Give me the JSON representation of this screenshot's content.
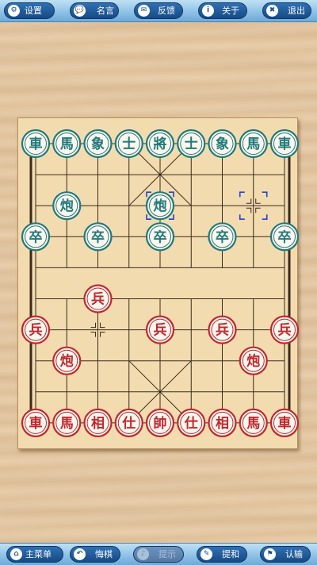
{
  "top_bar": {
    "buttons": [
      {
        "label": "设置",
        "icon": "gear-icon",
        "glyph": "⚙"
      },
      {
        "label": "名言",
        "icon": "speech-bubble-icon",
        "glyph": "💬"
      },
      {
        "label": "反馈",
        "icon": "mail-icon",
        "glyph": "✉"
      },
      {
        "label": "关于",
        "icon": "info-icon",
        "glyph": "i"
      },
      {
        "label": "退出",
        "icon": "close-icon",
        "glyph": "✖"
      }
    ]
  },
  "bottom_bar": {
    "buttons": [
      {
        "label": "主菜单",
        "icon": "home-icon",
        "glyph": "⌂",
        "enabled": true
      },
      {
        "label": "悔棋",
        "icon": "undo-icon",
        "glyph": "↶",
        "enabled": true
      },
      {
        "label": "提示",
        "icon": "bell-icon",
        "glyph": "♪",
        "enabled": false
      },
      {
        "label": "提和",
        "icon": "pencil-icon",
        "glyph": "✎",
        "enabled": true
      },
      {
        "label": "认输",
        "icon": "flag-icon",
        "glyph": "⚑",
        "enabled": true
      }
    ]
  },
  "colors": {
    "black_side": "#1f7a7a",
    "red_side": "#c1272d",
    "selection_marker": "#2244cc"
  },
  "pieces": [
    {
      "side": "black",
      "char": "車",
      "col": 0,
      "row": 0
    },
    {
      "side": "black",
      "char": "馬",
      "col": 1,
      "row": 0
    },
    {
      "side": "black",
      "char": "象",
      "col": 2,
      "row": 0
    },
    {
      "side": "black",
      "char": "士",
      "col": 3,
      "row": 0
    },
    {
      "side": "black",
      "char": "將",
      "col": 4,
      "row": 0
    },
    {
      "side": "black",
      "char": "士",
      "col": 5,
      "row": 0
    },
    {
      "side": "black",
      "char": "象",
      "col": 6,
      "row": 0
    },
    {
      "side": "black",
      "char": "馬",
      "col": 7,
      "row": 0
    },
    {
      "side": "black",
      "char": "車",
      "col": 8,
      "row": 0
    },
    {
      "side": "black",
      "char": "炮",
      "col": 1,
      "row": 2
    },
    {
      "side": "black",
      "char": "炮",
      "col": 4,
      "row": 2,
      "selected": true
    },
    {
      "side": "black",
      "char": "卒",
      "col": 0,
      "row": 3
    },
    {
      "side": "black",
      "char": "卒",
      "col": 2,
      "row": 3
    },
    {
      "side": "black",
      "char": "卒",
      "col": 4,
      "row": 3
    },
    {
      "side": "black",
      "char": "卒",
      "col": 6,
      "row": 3
    },
    {
      "side": "black",
      "char": "卒",
      "col": 8,
      "row": 3
    },
    {
      "side": "red",
      "char": "兵",
      "col": 2,
      "row": 5
    },
    {
      "side": "red",
      "char": "兵",
      "col": 0,
      "row": 6
    },
    {
      "side": "red",
      "char": "兵",
      "col": 4,
      "row": 6
    },
    {
      "side": "red",
      "char": "兵",
      "col": 6,
      "row": 6
    },
    {
      "side": "red",
      "char": "兵",
      "col": 8,
      "row": 6
    },
    {
      "side": "red",
      "char": "炮",
      "col": 1,
      "row": 7
    },
    {
      "side": "red",
      "char": "炮",
      "col": 7,
      "row": 7
    },
    {
      "side": "red",
      "char": "車",
      "col": 0,
      "row": 9
    },
    {
      "side": "red",
      "char": "馬",
      "col": 1,
      "row": 9
    },
    {
      "side": "red",
      "char": "相",
      "col": 2,
      "row": 9
    },
    {
      "side": "red",
      "char": "仕",
      "col": 3,
      "row": 9
    },
    {
      "side": "red",
      "char": "帥",
      "col": 4,
      "row": 9
    },
    {
      "side": "red",
      "char": "仕",
      "col": 5,
      "row": 9
    },
    {
      "side": "red",
      "char": "相",
      "col": 6,
      "row": 9
    },
    {
      "side": "red",
      "char": "馬",
      "col": 7,
      "row": 9
    },
    {
      "side": "red",
      "char": "車",
      "col": 8,
      "row": 9
    }
  ],
  "last_move_from": {
    "col": 7,
    "row": 2
  },
  "empty_point_marks": [
    {
      "col": 2,
      "row": 6
    }
  ]
}
